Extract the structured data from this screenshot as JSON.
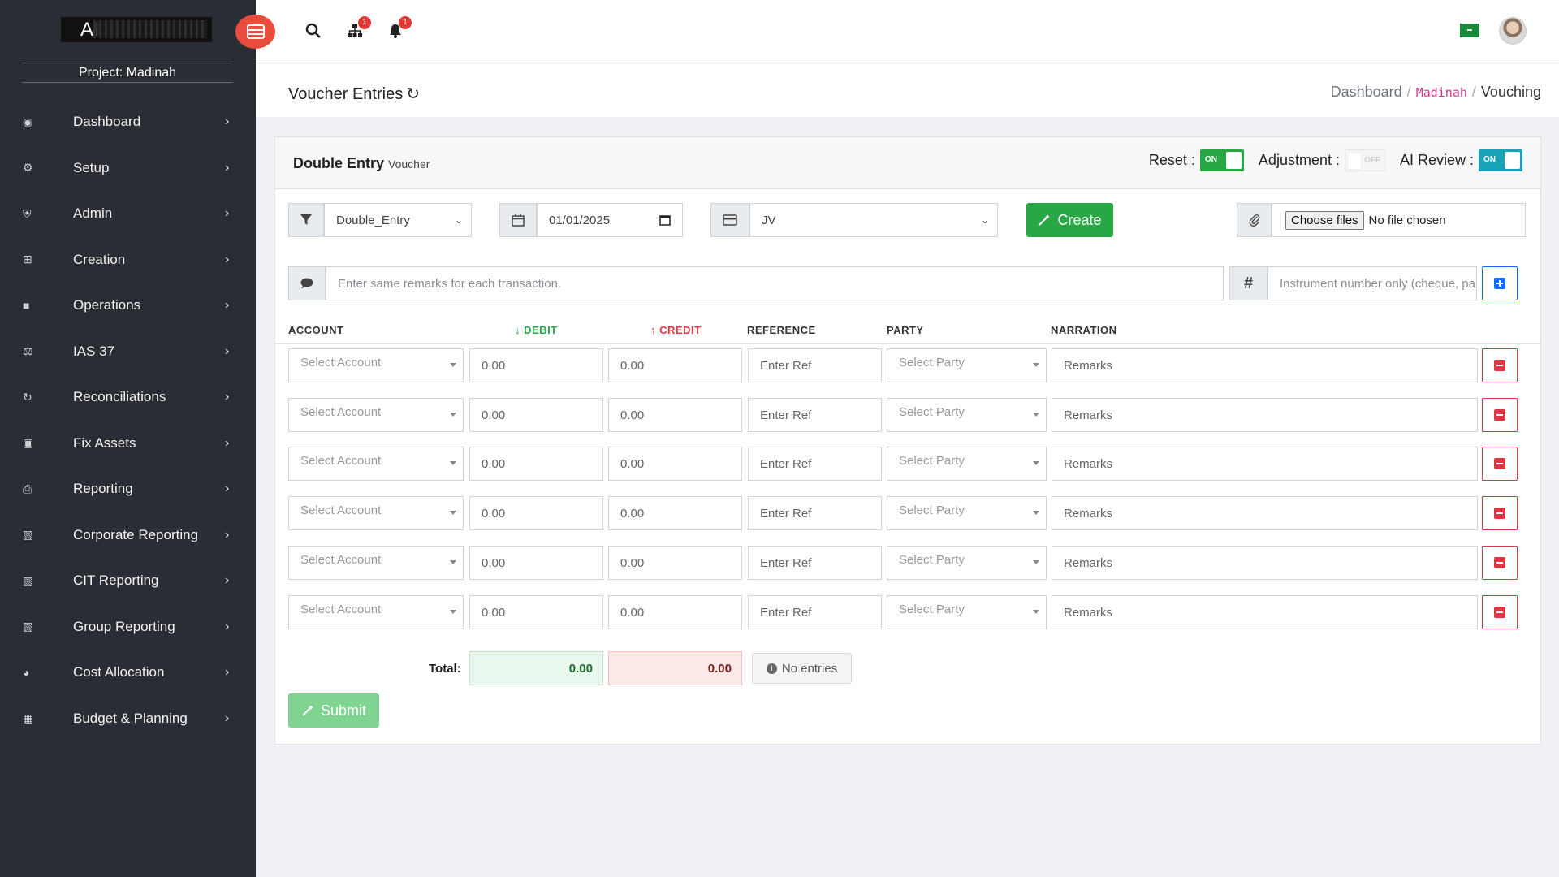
{
  "app": {
    "logo_text": "AI"
  },
  "sidebar": {
    "project_label": "Project: Madinah",
    "items": [
      {
        "label": "Dashboard",
        "icon": "palette-icon"
      },
      {
        "label": "Setup",
        "icon": "gear-icon"
      },
      {
        "label": "Admin",
        "icon": "shield-icon"
      },
      {
        "label": "Creation",
        "icon": "plus-square-icon"
      },
      {
        "label": "Operations",
        "icon": "cube-icon"
      },
      {
        "label": "IAS 37",
        "icon": "balance-scale-icon"
      },
      {
        "label": "Reconciliations",
        "icon": "sync-icon"
      },
      {
        "label": "Fix Assets",
        "icon": "archive-icon"
      },
      {
        "label": "Reporting",
        "icon": "print-icon"
      },
      {
        "label": "Corporate Reporting",
        "icon": "file-icon"
      },
      {
        "label": "CIT Reporting",
        "icon": "file-icon"
      },
      {
        "label": "Group Reporting",
        "icon": "file-icon"
      },
      {
        "label": "Cost Allocation",
        "icon": "pie-chart-icon"
      },
      {
        "label": "Budget & Planning",
        "icon": "calculator-icon"
      }
    ]
  },
  "topbar": {
    "hierarchy_badge": "1",
    "notifications_badge": "1"
  },
  "page": {
    "title": "Voucher Entries",
    "breadcrumb": {
      "home": "Dashboard",
      "project": "Madinah",
      "current": "Vouching"
    }
  },
  "card": {
    "title": "Double Entry",
    "subtitle": "Voucher",
    "toggles": {
      "reset_label": "Reset :",
      "reset_state": "ON",
      "adjustment_label": "Adjustment :",
      "adjustment_state": "OFF",
      "ai_review_label": "AI Review :",
      "ai_review_state": "ON"
    }
  },
  "form": {
    "entry_type": "Double_Entry",
    "date": "01/01/2025",
    "voucher_type": "JV",
    "create_label": "Create",
    "file_button": "Choose files",
    "file_status": "No file chosen",
    "remarks_placeholder": "Enter same remarks for each transaction.",
    "instrument_placeholder": "Instrument number only (cheque, pa"
  },
  "table": {
    "headers": {
      "account": "ACCOUNT",
      "debit": "DEBIT",
      "credit": "CREDIT",
      "reference": "REFERENCE",
      "party": "PARTY",
      "narration": "NARRATION"
    },
    "rows": [
      {
        "account": "Select Account",
        "debit": "0.00",
        "credit": "0.00",
        "reference": "Enter Ref",
        "party": "Select Party",
        "narration": "Remarks"
      },
      {
        "account": "Select Account",
        "debit": "0.00",
        "credit": "0.00",
        "reference": "Enter Ref",
        "party": "Select Party",
        "narration": "Remarks"
      },
      {
        "account": "Select Account",
        "debit": "0.00",
        "credit": "0.00",
        "reference": "Enter Ref",
        "party": "Select Party",
        "narration": "Remarks"
      },
      {
        "account": "Select Account",
        "debit": "0.00",
        "credit": "0.00",
        "reference": "Enter Ref",
        "party": "Select Party",
        "narration": "Remarks"
      },
      {
        "account": "Select Account",
        "debit": "0.00",
        "credit": "0.00",
        "reference": "Enter Ref",
        "party": "Select Party",
        "narration": "Remarks"
      },
      {
        "account": "Select Account",
        "debit": "0.00",
        "credit": "0.00",
        "reference": "Enter Ref",
        "party": "Select Party",
        "narration": "Remarks"
      }
    ]
  },
  "totals": {
    "label": "Total:",
    "debit": "0.00",
    "credit": "0.00",
    "status": "No entries"
  },
  "submit_label": "Submit",
  "colors": {
    "sidebar_bg": "#2a2d33",
    "accent_red": "#e84c3d",
    "success": "#28a745",
    "danger": "#dc3545",
    "info": "#17a2b8",
    "primary": "#0d6efd"
  }
}
